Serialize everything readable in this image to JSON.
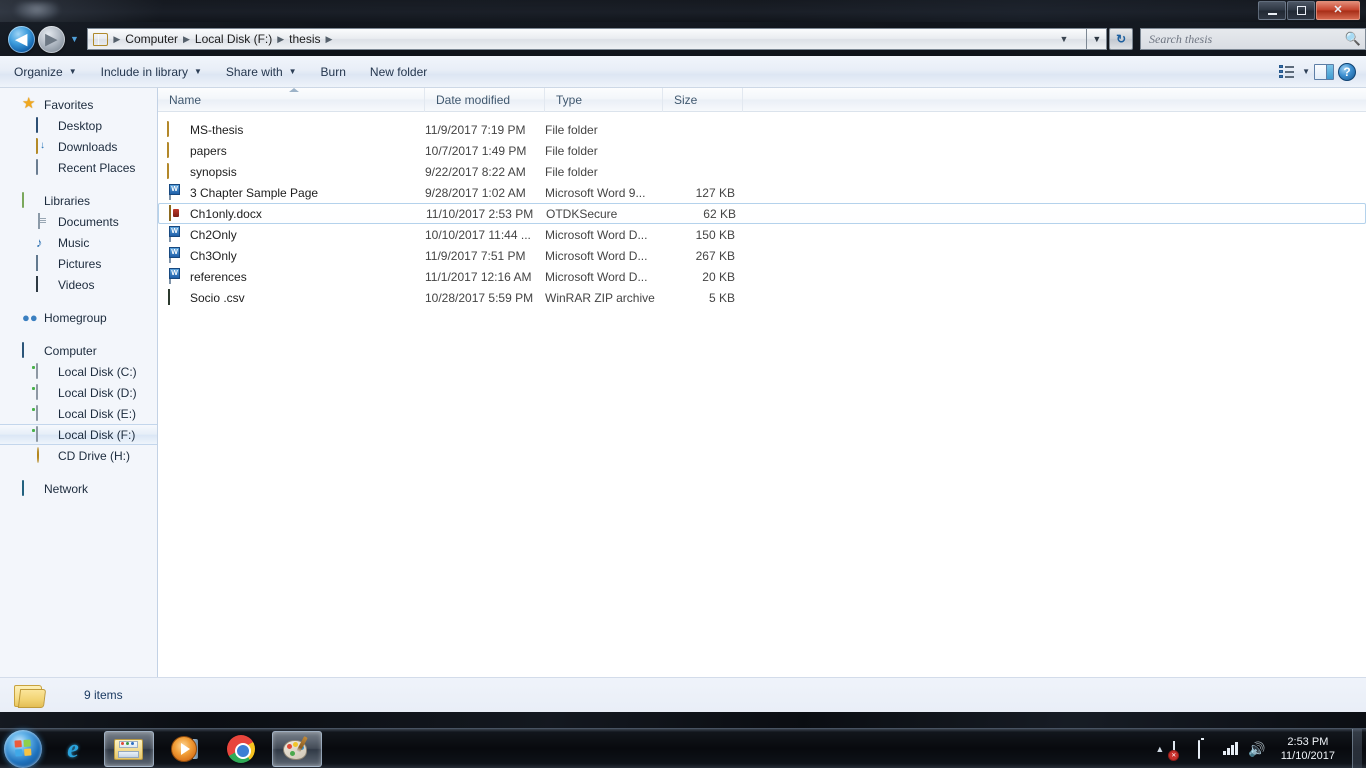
{
  "window": {
    "minimize_label": "Minimize",
    "maximize_label": "Maximize",
    "close_label": "✕"
  },
  "address_bar": {
    "back_label": "◀",
    "forward_label": "▶",
    "history_caret": "▼",
    "folder_icon": "folder-icon",
    "breadcrumbs": [
      "Computer",
      "Local Disk (F:)",
      "thesis"
    ],
    "separator": "▶",
    "dropdown_caret": "▼",
    "refresh_label": "↻"
  },
  "search": {
    "placeholder": "Search thesis",
    "value": "",
    "icon": "search-icon"
  },
  "toolbar": {
    "items": [
      {
        "label": "Organize",
        "caret": "▼"
      },
      {
        "label": "Include in library",
        "caret": "▼"
      },
      {
        "label": "Share with",
        "caret": "▼"
      },
      {
        "label": "Burn",
        "caret": ""
      },
      {
        "label": "New folder",
        "caret": ""
      }
    ],
    "views_caret": "▼",
    "help_label": "?"
  },
  "sidebar": {
    "groups": [
      {
        "header": {
          "label": "Favorites",
          "icon": "star-icon"
        },
        "items": [
          {
            "label": "Desktop",
            "icon": "monitor-icon"
          },
          {
            "label": "Downloads",
            "icon": "download-folder-icon"
          },
          {
            "label": "Recent Places",
            "icon": "recent-places-icon"
          }
        ]
      },
      {
        "header": {
          "label": "Libraries",
          "icon": "library-icon"
        },
        "items": [
          {
            "label": "Documents",
            "icon": "document-icon"
          },
          {
            "label": "Music",
            "icon": "music-note-icon"
          },
          {
            "label": "Pictures",
            "icon": "picture-icon"
          },
          {
            "label": "Videos",
            "icon": "video-icon"
          }
        ]
      },
      {
        "header": {
          "label": "Homegroup",
          "icon": "homegroup-icon"
        },
        "items": []
      },
      {
        "header": {
          "label": "Computer",
          "icon": "computer-icon"
        },
        "items": [
          {
            "label": "Local Disk (C:)",
            "icon": "system-drive-icon",
            "selected": false
          },
          {
            "label": "Local Disk (D:)",
            "icon": "drive-icon",
            "selected": false
          },
          {
            "label": "Local Disk (E:)",
            "icon": "drive-icon",
            "selected": false
          },
          {
            "label": "Local Disk (F:)",
            "icon": "drive-icon",
            "selected": true
          },
          {
            "label": "CD Drive (H:)",
            "icon": "cd-drive-icon",
            "selected": false
          }
        ]
      },
      {
        "header": {
          "label": "Network",
          "icon": "network-icon"
        },
        "items": []
      }
    ]
  },
  "file_list": {
    "columns": [
      {
        "label": "Name",
        "sorted": true
      },
      {
        "label": "Date modified",
        "sorted": false
      },
      {
        "label": "Type",
        "sorted": false
      },
      {
        "label": "Size",
        "sorted": false
      }
    ],
    "rows": [
      {
        "name": "MS-thesis",
        "date": "11/9/2017 7:19 PM",
        "type": "File folder",
        "size": "",
        "icon": "folder-icon",
        "selected": false
      },
      {
        "name": "papers",
        "date": "10/7/2017 1:49 PM",
        "type": "File folder",
        "size": "",
        "icon": "folder-icon",
        "selected": false
      },
      {
        "name": "synopsis",
        "date": "9/22/2017 8:22 AM",
        "type": "File folder",
        "size": "",
        "icon": "folder-icon",
        "selected": false
      },
      {
        "name": "3 Chapter Sample Page",
        "date": "9/28/2017 1:02 AM",
        "type": "Microsoft Word 9...",
        "size": "127 KB",
        "icon": "word-document-icon",
        "selected": false
      },
      {
        "name": "Ch1only.docx",
        "date": "11/10/2017 2:53 PM",
        "type": "OTDKSecure",
        "size": "62 KB",
        "icon": "secure-document-icon",
        "selected": true
      },
      {
        "name": "Ch2Only",
        "date": "10/10/2017 11:44 ...",
        "type": "Microsoft Word D...",
        "size": "150 KB",
        "icon": "word-document-icon",
        "selected": false
      },
      {
        "name": "Ch3Only",
        "date": "11/9/2017 7:51 PM",
        "type": "Microsoft Word D...",
        "size": "267 KB",
        "icon": "word-document-icon",
        "selected": false
      },
      {
        "name": "references",
        "date": "11/1/2017 12:16 AM",
        "type": "Microsoft Word D...",
        "size": "20 KB",
        "icon": "word-document-icon",
        "selected": false
      },
      {
        "name": "Socio .csv",
        "date": "10/28/2017 5:59 PM",
        "type": "WinRAR ZIP archive",
        "size": "5 KB",
        "icon": "winrar-archive-icon",
        "selected": false
      }
    ]
  },
  "status_bar": {
    "item_count": "9 items",
    "folder_icon": "open-folder-icon"
  },
  "taskbar": {
    "start_label": "Start",
    "apps": [
      {
        "name": "internet-explorer",
        "active": false
      },
      {
        "name": "windows-explorer",
        "active": true
      },
      {
        "name": "windows-media-player",
        "active": false
      },
      {
        "name": "google-chrome",
        "active": false
      },
      {
        "name": "paint",
        "active": true
      }
    ],
    "tray": {
      "overflow_arrow": "▲",
      "action_center": "flag-icon",
      "battery": "battery-icon",
      "network": "signal-bars-icon",
      "volume": "🔊",
      "time": "2:53 PM",
      "date": "11/10/2017"
    }
  },
  "colors": {
    "accent": "#2d6fa8",
    "selection_border": "#b4d2ec",
    "sidebar_bg": "#f3f6fb",
    "status_bg": "#eff3fa"
  }
}
